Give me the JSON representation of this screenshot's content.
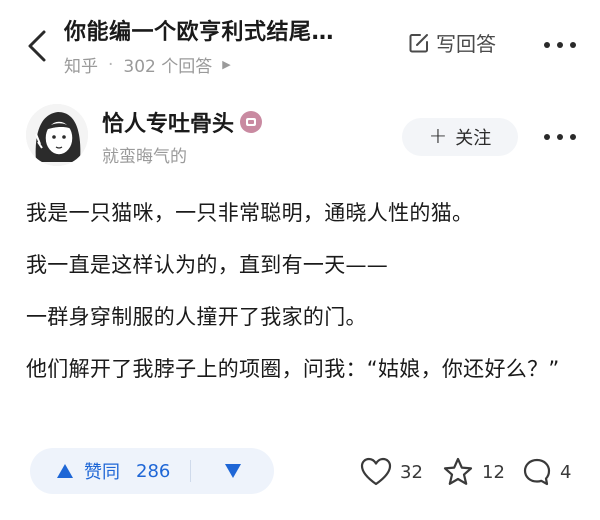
{
  "header": {
    "title": "你能编一个欧亨利式结尾…",
    "source": "知乎",
    "answer_count": "302 个回答",
    "write_answer_label": "写回答"
  },
  "author": {
    "name": "恰人专吐骨头",
    "bio": "就蛮晦气的",
    "follow_label": "关注"
  },
  "content": {
    "paragraphs": [
      "我是一只猫咪，一只非常聪明，通晓人性的猫。",
      "我一直是这样认为的，直到有一天——",
      "一群身穿制服的人撞开了我家的门。",
      "他们解开了我脖子上的项圈，问我：“姑娘，你还好么？”"
    ]
  },
  "actions": {
    "upvote_label": "赞同",
    "upvote_count": "286",
    "like_count": "32",
    "favorite_count": "12",
    "comment_count": "4"
  },
  "colors": {
    "accent": "#1e66d6",
    "vote_bg": "#eef3fb",
    "muted": "#9a9a9a"
  }
}
